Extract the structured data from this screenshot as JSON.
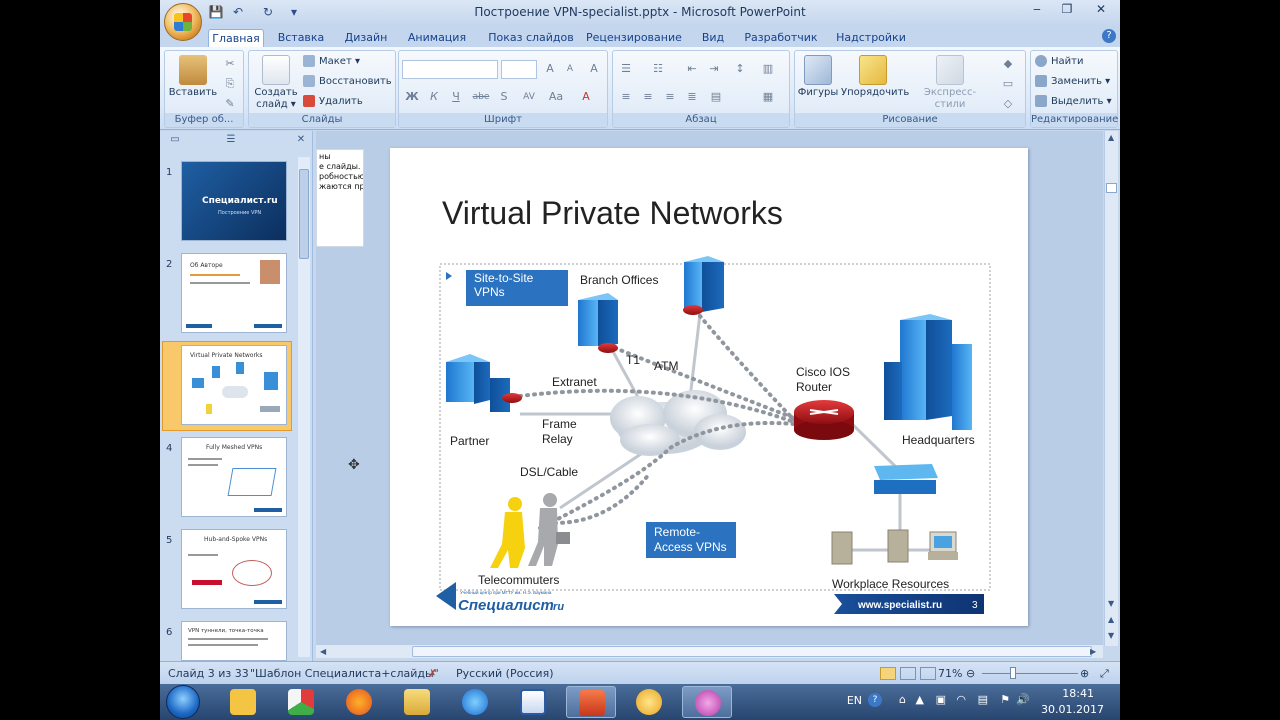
{
  "window": {
    "title": "Построение VPN-specialist.pptx - Microsoft PowerPoint",
    "minimize": "‒",
    "maximize": "❐",
    "close": "✕"
  },
  "qat": {
    "save": "💾",
    "undo": "↶",
    "redo": "↻",
    "customize": "▾"
  },
  "tabs": [
    {
      "label": "Главная"
    },
    {
      "label": "Вставка"
    },
    {
      "label": "Дизайн"
    },
    {
      "label": "Анимация"
    },
    {
      "label": "Показ слайдов"
    },
    {
      "label": "Рецензирование"
    },
    {
      "label": "Вид"
    },
    {
      "label": "Разработчик"
    },
    {
      "label": "Надстройки"
    }
  ],
  "help": "?",
  "ribbon": {
    "clipboard": {
      "label": "Буфер об...",
      "paste": "Вставить"
    },
    "slides": {
      "label": "Слайды",
      "new_slide": "Создать слайд ▾",
      "layout": "Макет ▾",
      "reset": "Восстановить",
      "delete": "Удалить"
    },
    "font": {
      "label": "Шрифт",
      "bold": "Ж",
      "italic": "К",
      "underline": "Ч",
      "strike": "abe",
      "shadow": "S",
      "spacing": "AV",
      "case": "Aa",
      "color": "A",
      "grow": "A",
      "shrink": "A",
      "clear": "A"
    },
    "paragraph": {
      "label": "Абзац"
    },
    "drawing": {
      "label": "Рисование",
      "shapes": "Фигуры",
      "arrange": "Упорядочить",
      "quick_styles": "Экспресс-стили"
    },
    "editing": {
      "label": "Редактирование",
      "find": "Найти",
      "replace": "Заменить ▾",
      "select": "Выделить ▾"
    }
  },
  "panel": {
    "thumbs": [
      {
        "num": "1",
        "title": "Специалист.ru",
        "sub": "Построение VPN"
      },
      {
        "num": "2",
        "title": "Об Авторе",
        "sub": ""
      },
      {
        "num": "3",
        "title": "Virtual Private Networks",
        "sub": ""
      },
      {
        "num": "4",
        "title": "Fully Meshed VPNs",
        "sub": ""
      },
      {
        "num": "5",
        "title": "Hub-and-Spoke VPNs",
        "sub": ""
      },
      {
        "num": "6",
        "title": "VPN туннели, точка-точка",
        "sub": ""
      }
    ]
  },
  "notes_peek": "ны\nе слайды.\nробностью.\nжаются при",
  "slide": {
    "title": "Virtual Private Networks",
    "site_to_site": "Site-to-Site\nVPNs",
    "branch_offices": "Branch Offices",
    "t1": "T1",
    "atm": "ATM",
    "extranet": "Extranet",
    "cisco_router": "Cisco IOS\nRouter",
    "partner": "Partner",
    "frame_relay": "Frame\nRelay",
    "headquarters": "Headquarters",
    "dsl_cable": "DSL/Cable",
    "remote_access": "Remote-\nAccess VPNs",
    "telecommuters": "Telecommuters",
    "workplace": "Workplace Resources",
    "logo_text": "Специалист",
    "logo_suffix": ".ru",
    "logo_tagline": "Учебный центр при МГТУ им. Н.Э. Баумана",
    "website": "www.specialist.ru",
    "page_num": "3"
  },
  "status": {
    "slide_info": "Слайд 3 из 33",
    "theme": "\"Шаблон Специалиста+слайды\"",
    "language": "Русский (Россия)",
    "zoom": "71%"
  },
  "tray": {
    "lang": "EN",
    "time": "18:41",
    "date": "30.01.2017"
  },
  "colors": {
    "accent_blue": "#2b72c0",
    "router_red": "#c8102e",
    "thumb_highlight": "#f9b53d"
  }
}
